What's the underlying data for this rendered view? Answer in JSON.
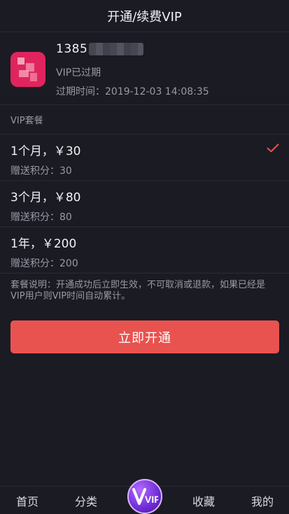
{
  "header": {
    "title": "开通/续费VIP"
  },
  "profile": {
    "phone": "1385",
    "vip_status": "VIP已过期",
    "expire_label": "过期时间：",
    "expire_value": "2019-12-03 14:08:35"
  },
  "plans": {
    "section_label": "VIP套餐",
    "items": [
      {
        "title": "1个月，￥30",
        "bonus": "赠送积分：30",
        "selected": true
      },
      {
        "title": "3个月，￥80",
        "bonus": "赠送积分：80",
        "selected": false
      },
      {
        "title": "1年，￥200",
        "bonus": "赠送积分：200",
        "selected": false
      }
    ]
  },
  "note": "套餐说明：开通成功后立即生效，不可取消或退款，如果已经是VIP用户则VIP时间自动累计。",
  "cta": {
    "label": "立即开通"
  },
  "tabbar": {
    "items": [
      {
        "label": "首页"
      },
      {
        "label": "分类"
      },
      {
        "label": "收藏"
      },
      {
        "label": "我的"
      }
    ],
    "center_icon": "vip-icon",
    "center_text": "VIP"
  },
  "colors": {
    "background": "#1b1b24",
    "accent": "#e8524f",
    "check": "#e8524f",
    "vip_purple": "#6f2bd6"
  }
}
